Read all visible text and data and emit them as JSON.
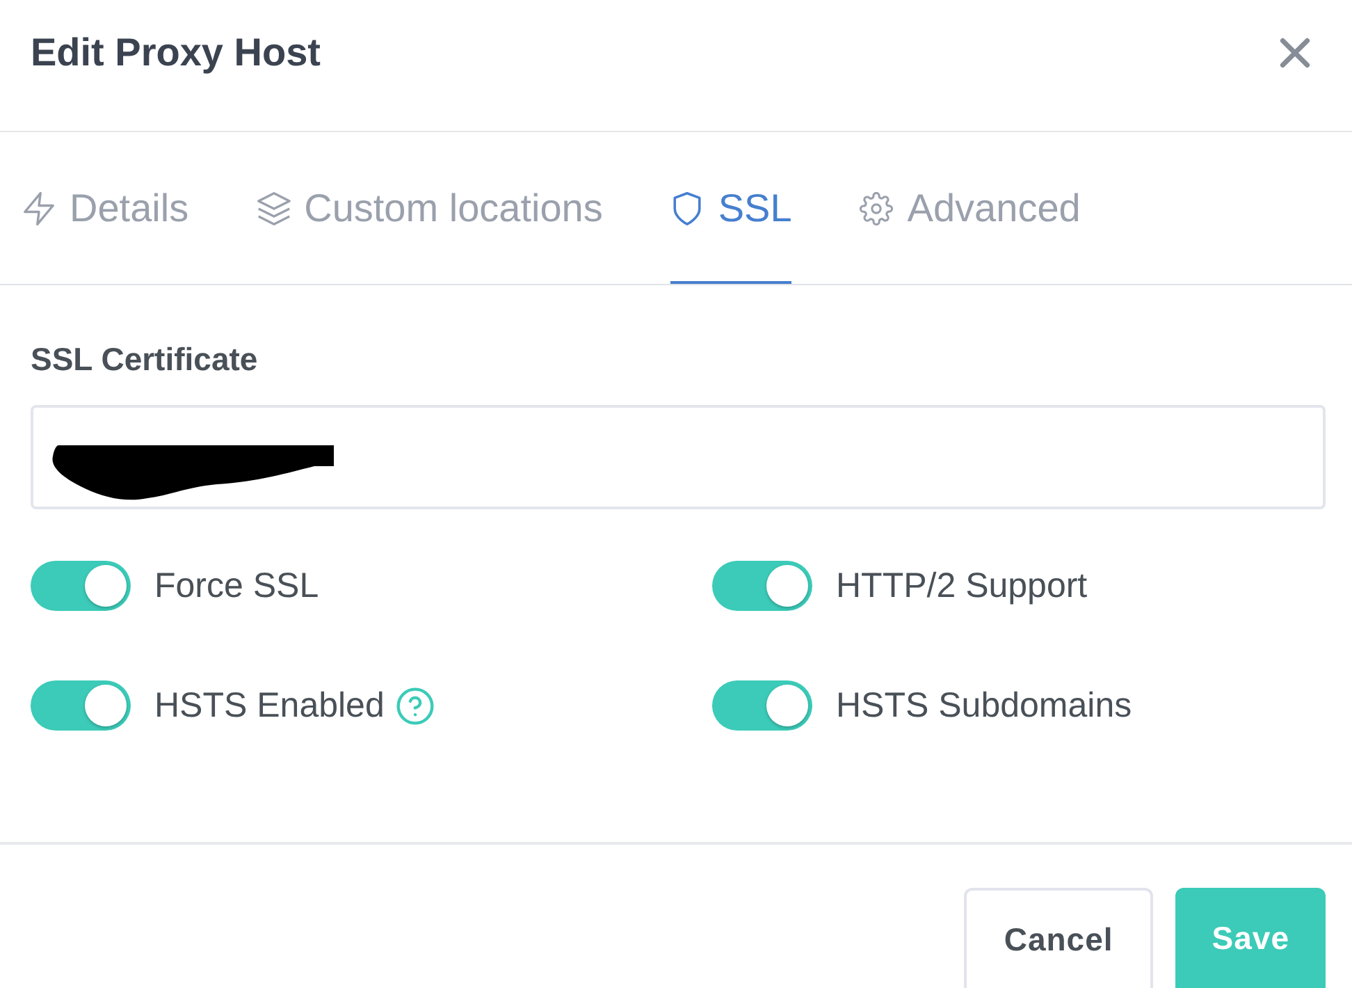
{
  "modal": {
    "title": "Edit Proxy Host"
  },
  "tabs": [
    {
      "label": "Details",
      "selected": false
    },
    {
      "label": "Custom locations",
      "selected": false
    },
    {
      "label": "SSL",
      "selected": true
    },
    {
      "label": "Advanced",
      "selected": false
    }
  ],
  "ssl_certificate": {
    "label": "SSL Certificate",
    "redacted": true
  },
  "toggles": [
    {
      "label": "Force SSL",
      "on": true,
      "help": false
    },
    {
      "label": "HTTP/2 Support",
      "on": true,
      "help": false
    },
    {
      "label": "HSTS Enabled",
      "on": true,
      "help": true
    },
    {
      "label": "HSTS Subdomains",
      "on": true,
      "help": false
    }
  ],
  "buttons": [
    {
      "label": "Cancel",
      "kind": "secondary"
    },
    {
      "label": "Save",
      "kind": "primary"
    }
  ]
}
